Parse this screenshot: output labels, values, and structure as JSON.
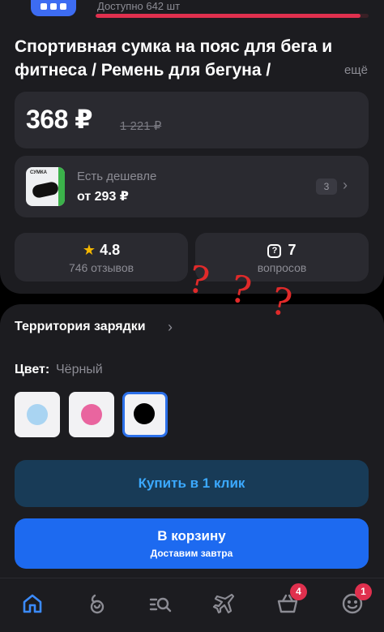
{
  "stock": {
    "label": "Доступно 642 шт",
    "fill_fraction": 0.97
  },
  "product": {
    "title": "Спортивная сумка на пояс для бега и фитнеса / Ремень для бегуна /",
    "more_link": "ещё"
  },
  "price": {
    "current": "368 ₽",
    "old": "1 221 ₽"
  },
  "cheaper": {
    "label": "Есть дешевле",
    "price": "от 293 ₽",
    "count": "3",
    "thumbnail_text": "СУМКА"
  },
  "stats": {
    "rating": {
      "value": "4.8",
      "label": "746 отзывов",
      "icon": "star-icon"
    },
    "questions": {
      "value": "7",
      "label": "вопросов",
      "icon": "question-bubble-icon"
    }
  },
  "annotation": {
    "marks": [
      "?",
      "?",
      "?"
    ],
    "color": "#e02a2a"
  },
  "brand": {
    "name": "Территория зарядки"
  },
  "color_select": {
    "label": "Цвет:",
    "value": "Чёрный",
    "swatches": [
      {
        "name": "light-blue",
        "hex": "#a9d4f2"
      },
      {
        "name": "pink",
        "hex": "#e9659f"
      },
      {
        "name": "black",
        "hex": "#000000",
        "selected": true
      }
    ]
  },
  "buttons": {
    "quick_buy": "Купить в 1 клик",
    "add_to_cart": "В корзину",
    "delivery": "Доставим завтра"
  },
  "tabbar": {
    "items": [
      {
        "icon": "home-icon",
        "active": true
      },
      {
        "icon": "catalog-icon"
      },
      {
        "icon": "search-icon"
      },
      {
        "icon": "plane-icon"
      },
      {
        "icon": "basket-icon",
        "badge": "4"
      },
      {
        "icon": "profile-icon",
        "badge": "1"
      }
    ]
  },
  "colors": {
    "accent": "#1d6af0",
    "danger": "#e0304e",
    "rating_star": "#f5b700"
  }
}
